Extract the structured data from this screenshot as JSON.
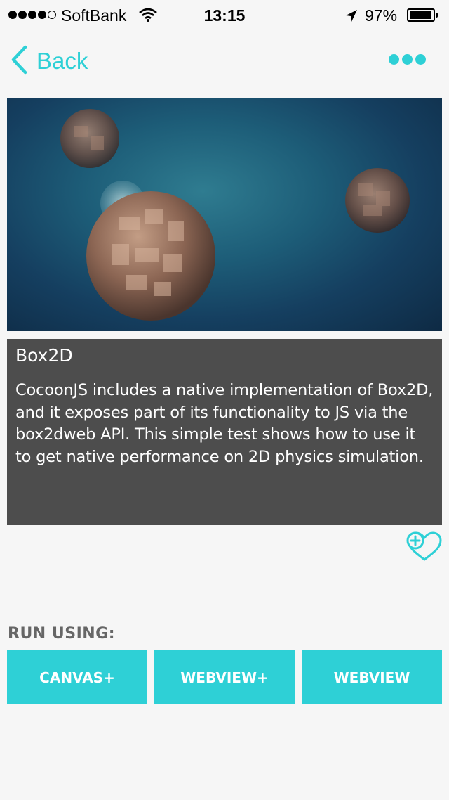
{
  "status": {
    "carrier": "SoftBank",
    "time": "13:15",
    "battery": "97%",
    "signal_bars": 4
  },
  "nav": {
    "back_label": "Back"
  },
  "demo": {
    "title": "Box2D",
    "description": "CocoonJS includes a native implementation of Box2D, and it exposes part of its functionality to JS via the box2dweb API. This simple test shows how to use it to get native performance on 2D physics simulation."
  },
  "run": {
    "label": "RUN USING:",
    "buttons": [
      "CANVAS+",
      "WEBVIEW+",
      "WEBVIEW"
    ]
  },
  "colors": {
    "accent": "#2ed0d6",
    "card_bg": "#4d4d4d",
    "page_bg": "#f6f6f6"
  },
  "icons": {
    "back": "chevron-left-icon",
    "more": "more-dots-icon",
    "favorite": "heart-plus-icon",
    "wifi": "wifi-icon",
    "location": "location-arrow-icon",
    "battery": "battery-icon"
  }
}
